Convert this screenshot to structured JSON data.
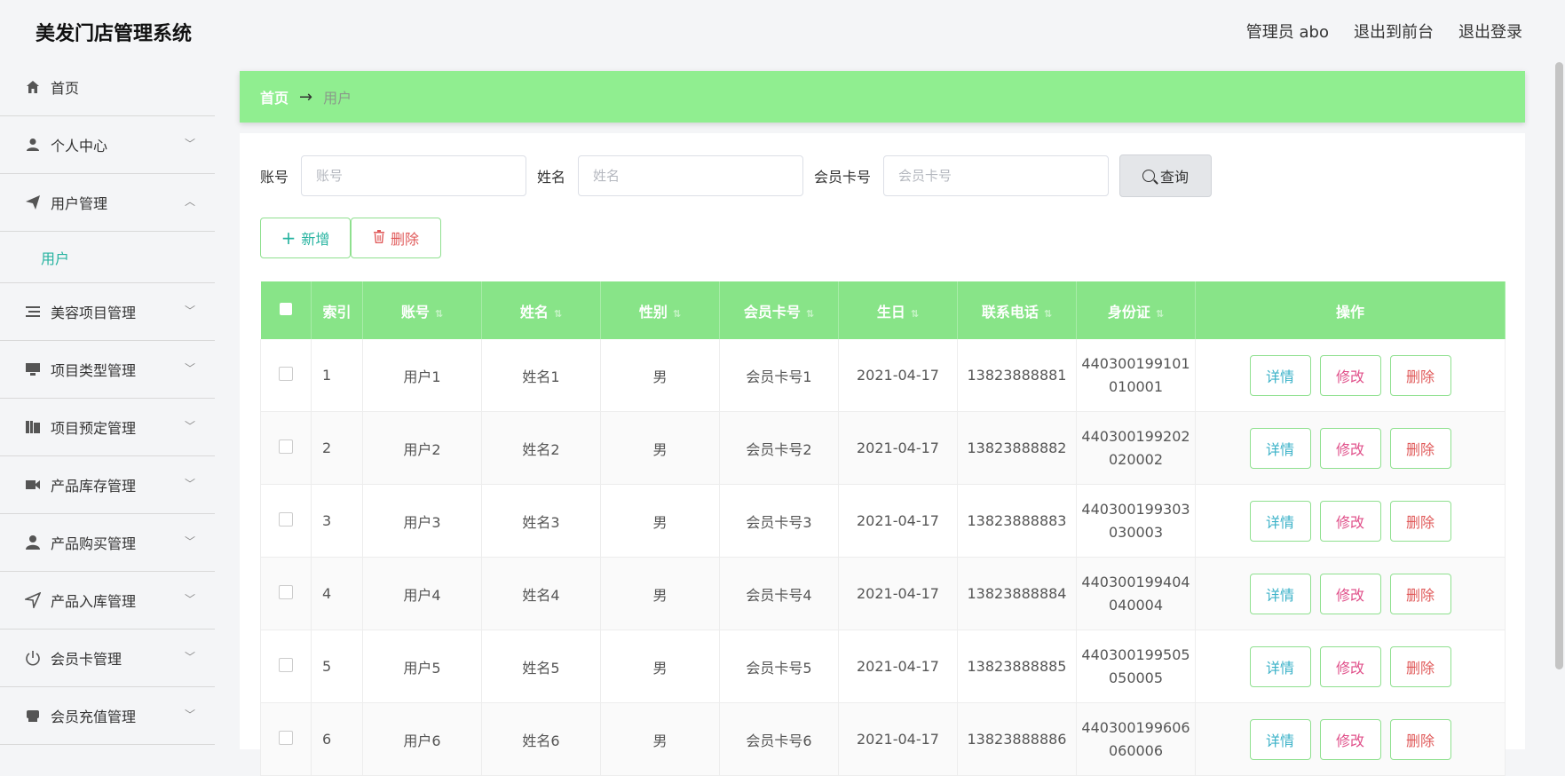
{
  "header": {
    "app_title": "美发门店管理系统",
    "admin_label": "管理员 abo",
    "exit_front": "退出到前台",
    "logout": "退出登录"
  },
  "sidebar": {
    "items": [
      {
        "label": "首页",
        "icon": "home-icon"
      },
      {
        "label": "个人中心",
        "icon": "user-icon"
      },
      {
        "label": "用户管理",
        "icon": "send-icon"
      },
      {
        "label": "美容项目管理",
        "icon": "list-icon"
      },
      {
        "label": "项目类型管理",
        "icon": "monitor-icon"
      },
      {
        "label": "项目预定管理",
        "icon": "book-icon"
      },
      {
        "label": "产品库存管理",
        "icon": "video-icon"
      },
      {
        "label": "产品购买管理",
        "icon": "person-icon"
      },
      {
        "label": "产品入库管理",
        "icon": "navigation-icon"
      },
      {
        "label": "会员卡管理",
        "icon": "power-icon"
      },
      {
        "label": "会员充值管理",
        "icon": "printer-icon"
      }
    ],
    "sub_item": "用户"
  },
  "breadcrumb": {
    "home": "首页",
    "arrow": "→",
    "current": "用户"
  },
  "search": {
    "account_label": "账号",
    "account_placeholder": "账号",
    "name_label": "姓名",
    "name_placeholder": "姓名",
    "card_label": "会员卡号",
    "card_placeholder": "会员卡号",
    "query_label": "查询"
  },
  "actions": {
    "add": "新增",
    "delete": "删除"
  },
  "table": {
    "headers": [
      "索引",
      "账号",
      "姓名",
      "性别",
      "会员卡号",
      "生日",
      "联系电话",
      "身份证",
      "操作"
    ],
    "ops": {
      "detail": "详情",
      "edit": "修改",
      "remove": "删除"
    },
    "rows": [
      {
        "idx": "1",
        "account": "用户1",
        "name": "姓名1",
        "gender": "男",
        "card": "会员卡号1",
        "birthday": "2021-04-17",
        "phone": "13823888881",
        "id1": "440300199101",
        "id2": "010001"
      },
      {
        "idx": "2",
        "account": "用户2",
        "name": "姓名2",
        "gender": "男",
        "card": "会员卡号2",
        "birthday": "2021-04-17",
        "phone": "13823888882",
        "id1": "440300199202",
        "id2": "020002"
      },
      {
        "idx": "3",
        "account": "用户3",
        "name": "姓名3",
        "gender": "男",
        "card": "会员卡号3",
        "birthday": "2021-04-17",
        "phone": "13823888883",
        "id1": "440300199303",
        "id2": "030003"
      },
      {
        "idx": "4",
        "account": "用户4",
        "name": "姓名4",
        "gender": "男",
        "card": "会员卡号4",
        "birthday": "2021-04-17",
        "phone": "13823888884",
        "id1": "440300199404",
        "id2": "040004"
      },
      {
        "idx": "5",
        "account": "用户5",
        "name": "姓名5",
        "gender": "男",
        "card": "会员卡号5",
        "birthday": "2021-04-17",
        "phone": "13823888885",
        "id1": "440300199505",
        "id2": "050005"
      },
      {
        "idx": "6",
        "account": "用户6",
        "name": "姓名6",
        "gender": "男",
        "card": "会员卡号6",
        "birthday": "2021-04-17",
        "phone": "13823888886",
        "id1": "440300199606",
        "id2": "060006"
      }
    ]
  },
  "colors": {
    "accent": "#90ee90",
    "header_green": "#88e488",
    "active_sub": "#26b3a0"
  }
}
